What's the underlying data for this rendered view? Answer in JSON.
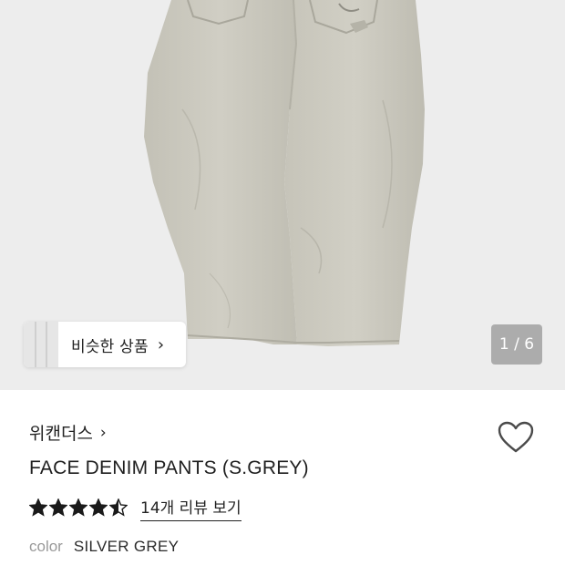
{
  "similar": {
    "label": "비슷한 상품",
    "chevron": "chevron-right-icon"
  },
  "gallery": {
    "counter": "1 / 6"
  },
  "product": {
    "brand": "위캔더스",
    "title": "FACE DENIM PANTS (S.GREY)",
    "rating_value": 4.5,
    "rating_max": 5,
    "review_link": "14개 리뷰 보기",
    "color_key": "color",
    "color_value": "SILVER GREY"
  },
  "colors": {
    "accent_text": "#1a1a1a",
    "muted": "#9a9a9a",
    "hero_bg": "#ededed",
    "denim": "#c9c7bd"
  },
  "icons": {
    "wishlist": "heart-outline-icon",
    "brand_chevron": "chevron-right-icon"
  }
}
